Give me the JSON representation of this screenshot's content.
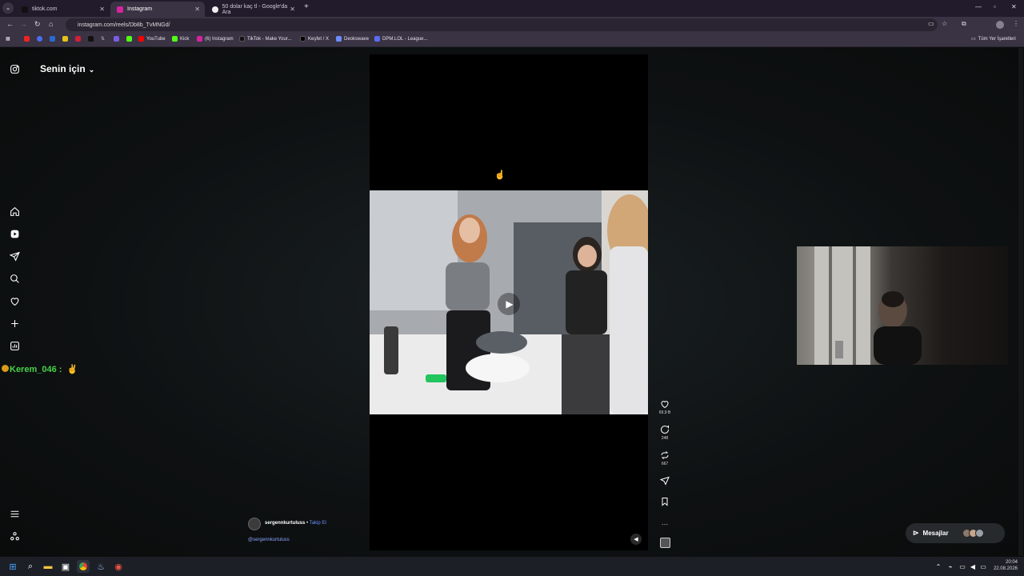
{
  "browser": {
    "tabs": [
      {
        "label": "tiktok.com",
        "active": false
      },
      {
        "label": "Instagram",
        "active": true
      },
      {
        "label": "50 dolar kaç tl - Google'da Ara",
        "active": false
      }
    ],
    "url": "instagram.com/reels/Db8b_TvMNGd/",
    "bookmarks": [
      "YouTube",
      "Kick",
      "(6) Instagram",
      "TikTok - Make Your...",
      "Keşfet / X",
      "Deokswave",
      "DPM.LOL - League..."
    ],
    "all_bookmarks": "Tüm Yer İşaretleri"
  },
  "instagram": {
    "feed_title": "Senin için",
    "author": "sergennkurtuluss",
    "follow_label": "Takip Et",
    "mention": "@sergennkurtuluss",
    "likes": "69,9 B",
    "comments": "248",
    "shares": "667",
    "messages_label": "Mesajlar"
  },
  "overlay": {
    "chat_user": "Kerem_046 :"
  },
  "taskbar": {
    "time": "20:04",
    "date": "22.08.2026"
  },
  "colors": {
    "accent_link": "#6f8fff",
    "chat_green": "#49d14a"
  }
}
